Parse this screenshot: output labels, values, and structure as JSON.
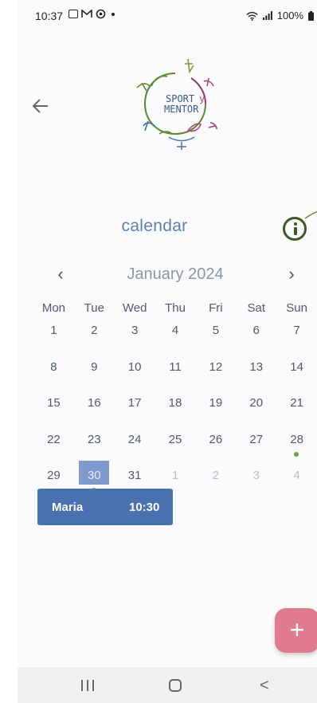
{
  "status_bar": {
    "time": "10:37",
    "battery": "100%",
    "left_icons": [
      "gallery-icon",
      "gmail-icon",
      "sync-icon",
      "dot-icon"
    ],
    "right_icons": [
      "wifi-icon",
      "signal-icon",
      "battery-icon"
    ]
  },
  "header": {
    "back_icon": "back-arrow-icon",
    "logo": {
      "line1": "SPORT",
      "line1_suffix": "y",
      "line2": "MENTOR"
    }
  },
  "page": {
    "title": "calendar",
    "info_icon": "info-icon"
  },
  "calendar": {
    "month_label": "January 2024",
    "prev_icon": "chevron-left-icon",
    "next_icon": "chevron-right-icon",
    "prev_label": "‹",
    "next_label": "›",
    "weekdays": [
      "Mon",
      "Tue",
      "Wed",
      "Thu",
      "Fri",
      "Sat",
      "Sun"
    ],
    "weeks": [
      [
        {
          "d": "1"
        },
        {
          "d": "2"
        },
        {
          "d": "3"
        },
        {
          "d": "4"
        },
        {
          "d": "5"
        },
        {
          "d": "6"
        },
        {
          "d": "7"
        }
      ],
      [
        {
          "d": "8"
        },
        {
          "d": "9"
        },
        {
          "d": "10"
        },
        {
          "d": "11"
        },
        {
          "d": "12"
        },
        {
          "d": "13"
        },
        {
          "d": "14"
        }
      ],
      [
        {
          "d": "15"
        },
        {
          "d": "16"
        },
        {
          "d": "17"
        },
        {
          "d": "18"
        },
        {
          "d": "19"
        },
        {
          "d": "20"
        },
        {
          "d": "21"
        }
      ],
      [
        {
          "d": "22"
        },
        {
          "d": "23"
        },
        {
          "d": "24"
        },
        {
          "d": "25"
        },
        {
          "d": "26"
        },
        {
          "d": "27"
        },
        {
          "d": "28",
          "event": true
        }
      ],
      [
        {
          "d": "29"
        },
        {
          "d": "30",
          "selected": true,
          "event": true
        },
        {
          "d": "31"
        },
        {
          "d": "1",
          "muted": true
        },
        {
          "d": "2",
          "muted": true
        },
        {
          "d": "3",
          "muted": true
        },
        {
          "d": "4",
          "muted": true
        }
      ]
    ]
  },
  "event": {
    "name": "Maria",
    "time": "10:30"
  },
  "fab": {
    "label": "+",
    "icon": "plus-icon"
  },
  "nav_bar": {
    "recent_icon": "recent-apps-icon",
    "home_icon": "home-icon",
    "back_icon": "back-icon",
    "back_label": "<"
  },
  "colors": {
    "title": "#5d7fb0",
    "selected_day": "#7f9acc",
    "event_dot": "#6aa834",
    "event_card": "#4a72b0",
    "fab": "#e07b8f",
    "info": "#3e5a25"
  }
}
